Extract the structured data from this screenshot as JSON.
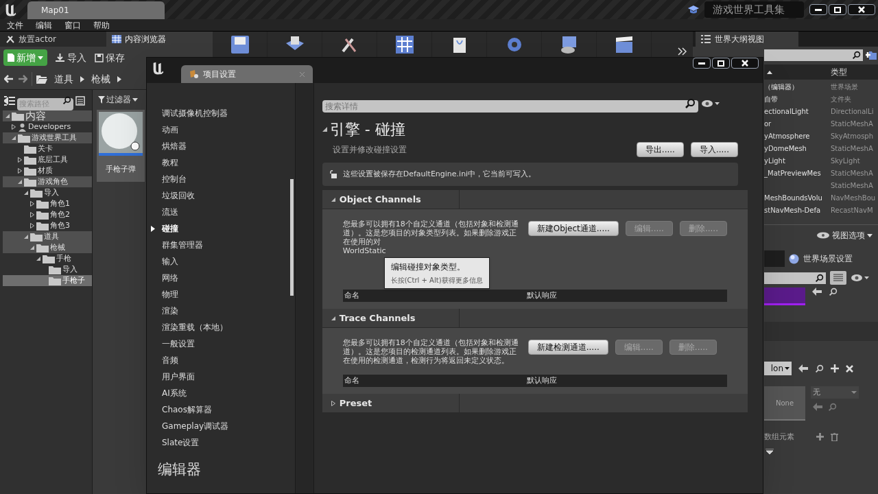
{
  "title_bar": {
    "tab": "Map01",
    "project": "游戏世界工具集"
  },
  "menu": [
    "文件",
    "编辑",
    "窗口",
    "帮助"
  ],
  "left_tabs": [
    {
      "label": "放置actor",
      "selected": false
    },
    {
      "label": "内容浏览器",
      "selected": true
    }
  ],
  "content_toolbar": {
    "new": "新增",
    "import": "导入",
    "save": "保存"
  },
  "breadcrumb": [
    "道具",
    "枪械"
  ],
  "path_search": {
    "placeholder": "搜索路径"
  },
  "filter": "过滤器",
  "tree": [
    {
      "label": "内容",
      "kind": "folder",
      "expanded": true,
      "in_path": true,
      "selected": false,
      "children": [
        {
          "label": "Developers",
          "kind": "user",
          "expanded": false,
          "in_path": false,
          "selected": false
        },
        {
          "label": "游戏世界工具",
          "kind": "folder",
          "expanded": true,
          "in_path": true,
          "selected": false,
          "children": [
            {
              "label": "关卡",
              "kind": "folder",
              "expanded": false,
              "in_path": false,
              "selected": false,
              "leaf": true
            },
            {
              "label": "底层工具",
              "kind": "folder",
              "expanded": false,
              "in_path": false,
              "selected": false
            },
            {
              "label": "材质",
              "kind": "folder",
              "expanded": false,
              "in_path": false,
              "selected": false
            },
            {
              "label": "游戏角色",
              "kind": "folder",
              "expanded": true,
              "in_path": true,
              "selected": false,
              "children": [
                {
                  "label": "导入",
                  "kind": "folder",
                  "expanded": true,
                  "in_path": false,
                  "selected": false,
                  "children": [
                    {
                      "label": "角色1",
                      "kind": "folder",
                      "expanded": false,
                      "in_path": false,
                      "selected": false
                    },
                    {
                      "label": "角色2",
                      "kind": "folder",
                      "expanded": false,
                      "in_path": false,
                      "selected": false
                    },
                    {
                      "label": "角色3",
                      "kind": "folder",
                      "expanded": false,
                      "in_path": false,
                      "selected": false
                    }
                  ]
                },
                {
                  "label": "道具",
                  "kind": "folder",
                  "expanded": true,
                  "in_path": true,
                  "selected": false,
                  "children": [
                    {
                      "label": "枪械",
                      "kind": "folder",
                      "expanded": true,
                      "in_path": true,
                      "selected": false,
                      "children": [
                        {
                          "label": "手枪",
                          "kind": "folder",
                          "expanded": true,
                          "in_path": false,
                          "selected": false,
                          "children": [
                            {
                              "label": "导入",
                              "kind": "folder",
                              "expanded": false,
                              "in_path": false,
                              "selected": false,
                              "leaf": true
                            },
                            {
                              "label": "手枪子",
                              "kind": "folder",
                              "expanded": false,
                              "selected": true,
                              "leaf": true
                            }
                          ]
                        }
                      ]
                    }
                  ]
                }
              ]
            }
          ]
        }
      ]
    }
  ],
  "asset": {
    "label": "手枪子弹"
  },
  "outliner": {
    "tab": "世界大纲视图",
    "column": "类型",
    "view_options": "视图选项",
    "rows": [
      {
        "name": "（编辑器）",
        "type": "世界场景"
      },
      {
        "name": "自带",
        "type": "文件夹"
      },
      {
        "name": "ectionalLight",
        "type": "DirectionalLi"
      },
      {
        "name": "or",
        "type": "StaticMeshA"
      },
      {
        "name": "yAtmosphere",
        "type": "SkyAtmosph"
      },
      {
        "name": "yDomeMesh",
        "type": "StaticMeshA"
      },
      {
        "name": "yLight",
        "type": "SkyLight"
      },
      {
        "name": "_MatPreviewMes",
        "type": "StaticMeshA"
      },
      {
        "name": "",
        "type": "StaticMeshA"
      },
      {
        "name": "MeshBoundsVolu",
        "type": "NavMeshBou"
      },
      {
        "name": "stNavMesh-Defa",
        "type": "RecastNavM"
      }
    ]
  },
  "world_settings": {
    "tab": "世界场景设置",
    "dropdown": "lon",
    "thumbnail": "None",
    "asset_dropdown": "无",
    "array_label": "数组元素"
  },
  "dialog": {
    "tab": "项目设置",
    "nav": [
      {
        "label": "调试摄像机控制器",
        "selected": false
      },
      {
        "label": "动画",
        "selected": false
      },
      {
        "label": "烘焙器",
        "selected": false
      },
      {
        "label": "教程",
        "selected": false
      },
      {
        "label": "控制台",
        "selected": false
      },
      {
        "label": "垃圾回收",
        "selected": false
      },
      {
        "label": "流送",
        "selected": false
      },
      {
        "label": "碰撞",
        "selected": true
      },
      {
        "label": "群集管理器",
        "selected": false
      },
      {
        "label": "输入",
        "selected": false
      },
      {
        "label": "网络",
        "selected": false
      },
      {
        "label": "物理",
        "selected": false
      },
      {
        "label": "渲染",
        "selected": false
      },
      {
        "label": "渲染重载（本地）",
        "selected": false
      },
      {
        "label": "一般设置",
        "selected": false
      },
      {
        "label": "音频",
        "selected": false
      },
      {
        "label": "用户界面",
        "selected": false
      },
      {
        "label": "AI系统",
        "selected": false
      },
      {
        "label": "Chaos解算器",
        "selected": false
      },
      {
        "label": "Gameplay调试器",
        "selected": false
      },
      {
        "label": "Slate设置",
        "selected": false
      }
    ],
    "nav_heading": "编辑器",
    "search": {
      "placeholder": "搜索详情"
    },
    "title": "引擎 - 碰撞",
    "subtitle": "设置并修改碰撞设置",
    "export": "导出.....",
    "import": "导入.....",
    "notice": "这些设置被保存在DefaultEngine.ini中，它当前可写入。",
    "sections": [
      {
        "title": "Object Channels",
        "expanded": true,
        "description": [
          "您最多可以拥有18个自定义通道（包括对象和检测通道）。这是您项目的对象类型列表。如果删除游戏正在使用的对",
          "WorldStatic"
        ],
        "new_button": "新建Object通道.....",
        "edit": "编辑.....",
        "delete": "删除.....",
        "columns": [
          "命名",
          "默认响应"
        ],
        "tooltip": {
          "title": "编辑碰撞对象类型。",
          "hint": "长按(Ctrl + Alt)获得更多信息"
        }
      },
      {
        "title": "Trace Channels",
        "expanded": true,
        "description": [
          "您最多可以拥有18个自定义通道（包括对象和检测通道）。这是您项目的检测通道列表。如果删除游戏正在使用的检测通道，检测行为将返回未定义状态。"
        ],
        "new_button": "新建检测通道.....",
        "edit": "编辑.....",
        "delete": "删除.....",
        "columns": [
          "命名",
          "默认响应"
        ]
      },
      {
        "title": "Preset",
        "expanded": false
      }
    ]
  }
}
